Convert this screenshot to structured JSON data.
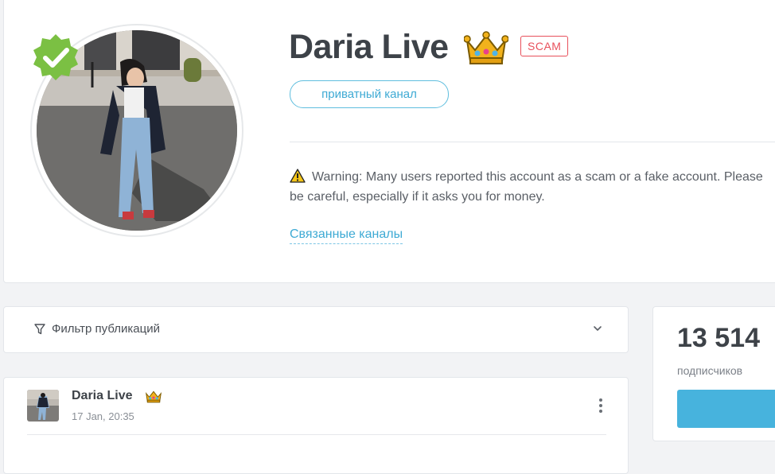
{
  "profile": {
    "name": "Daria Live",
    "scam_badge": "SCAM",
    "channel_type": "приватный канал",
    "warning": "Warning: Many users reported this account as a scam or a fake account. Please be careful, especially if it asks you for money.",
    "related_link": "Связанные каналы",
    "verified": true,
    "crown_icon": "crown-emoji"
  },
  "filter": {
    "label": "Фильтр публикаций",
    "icon": "funnel-icon",
    "expand_icon": "chevron-down-icon"
  },
  "stats": {
    "subscribers_count": "13 514",
    "subscribers_label": "подписчиков"
  },
  "post": {
    "author": "Daria Live",
    "date": "17 Jan, 20:35",
    "menu_icon": "kebab-icon"
  },
  "colors": {
    "accent": "#3eaad4",
    "scam": "#e8505b",
    "verified": "#7bc043",
    "button": "#47b3dd"
  }
}
